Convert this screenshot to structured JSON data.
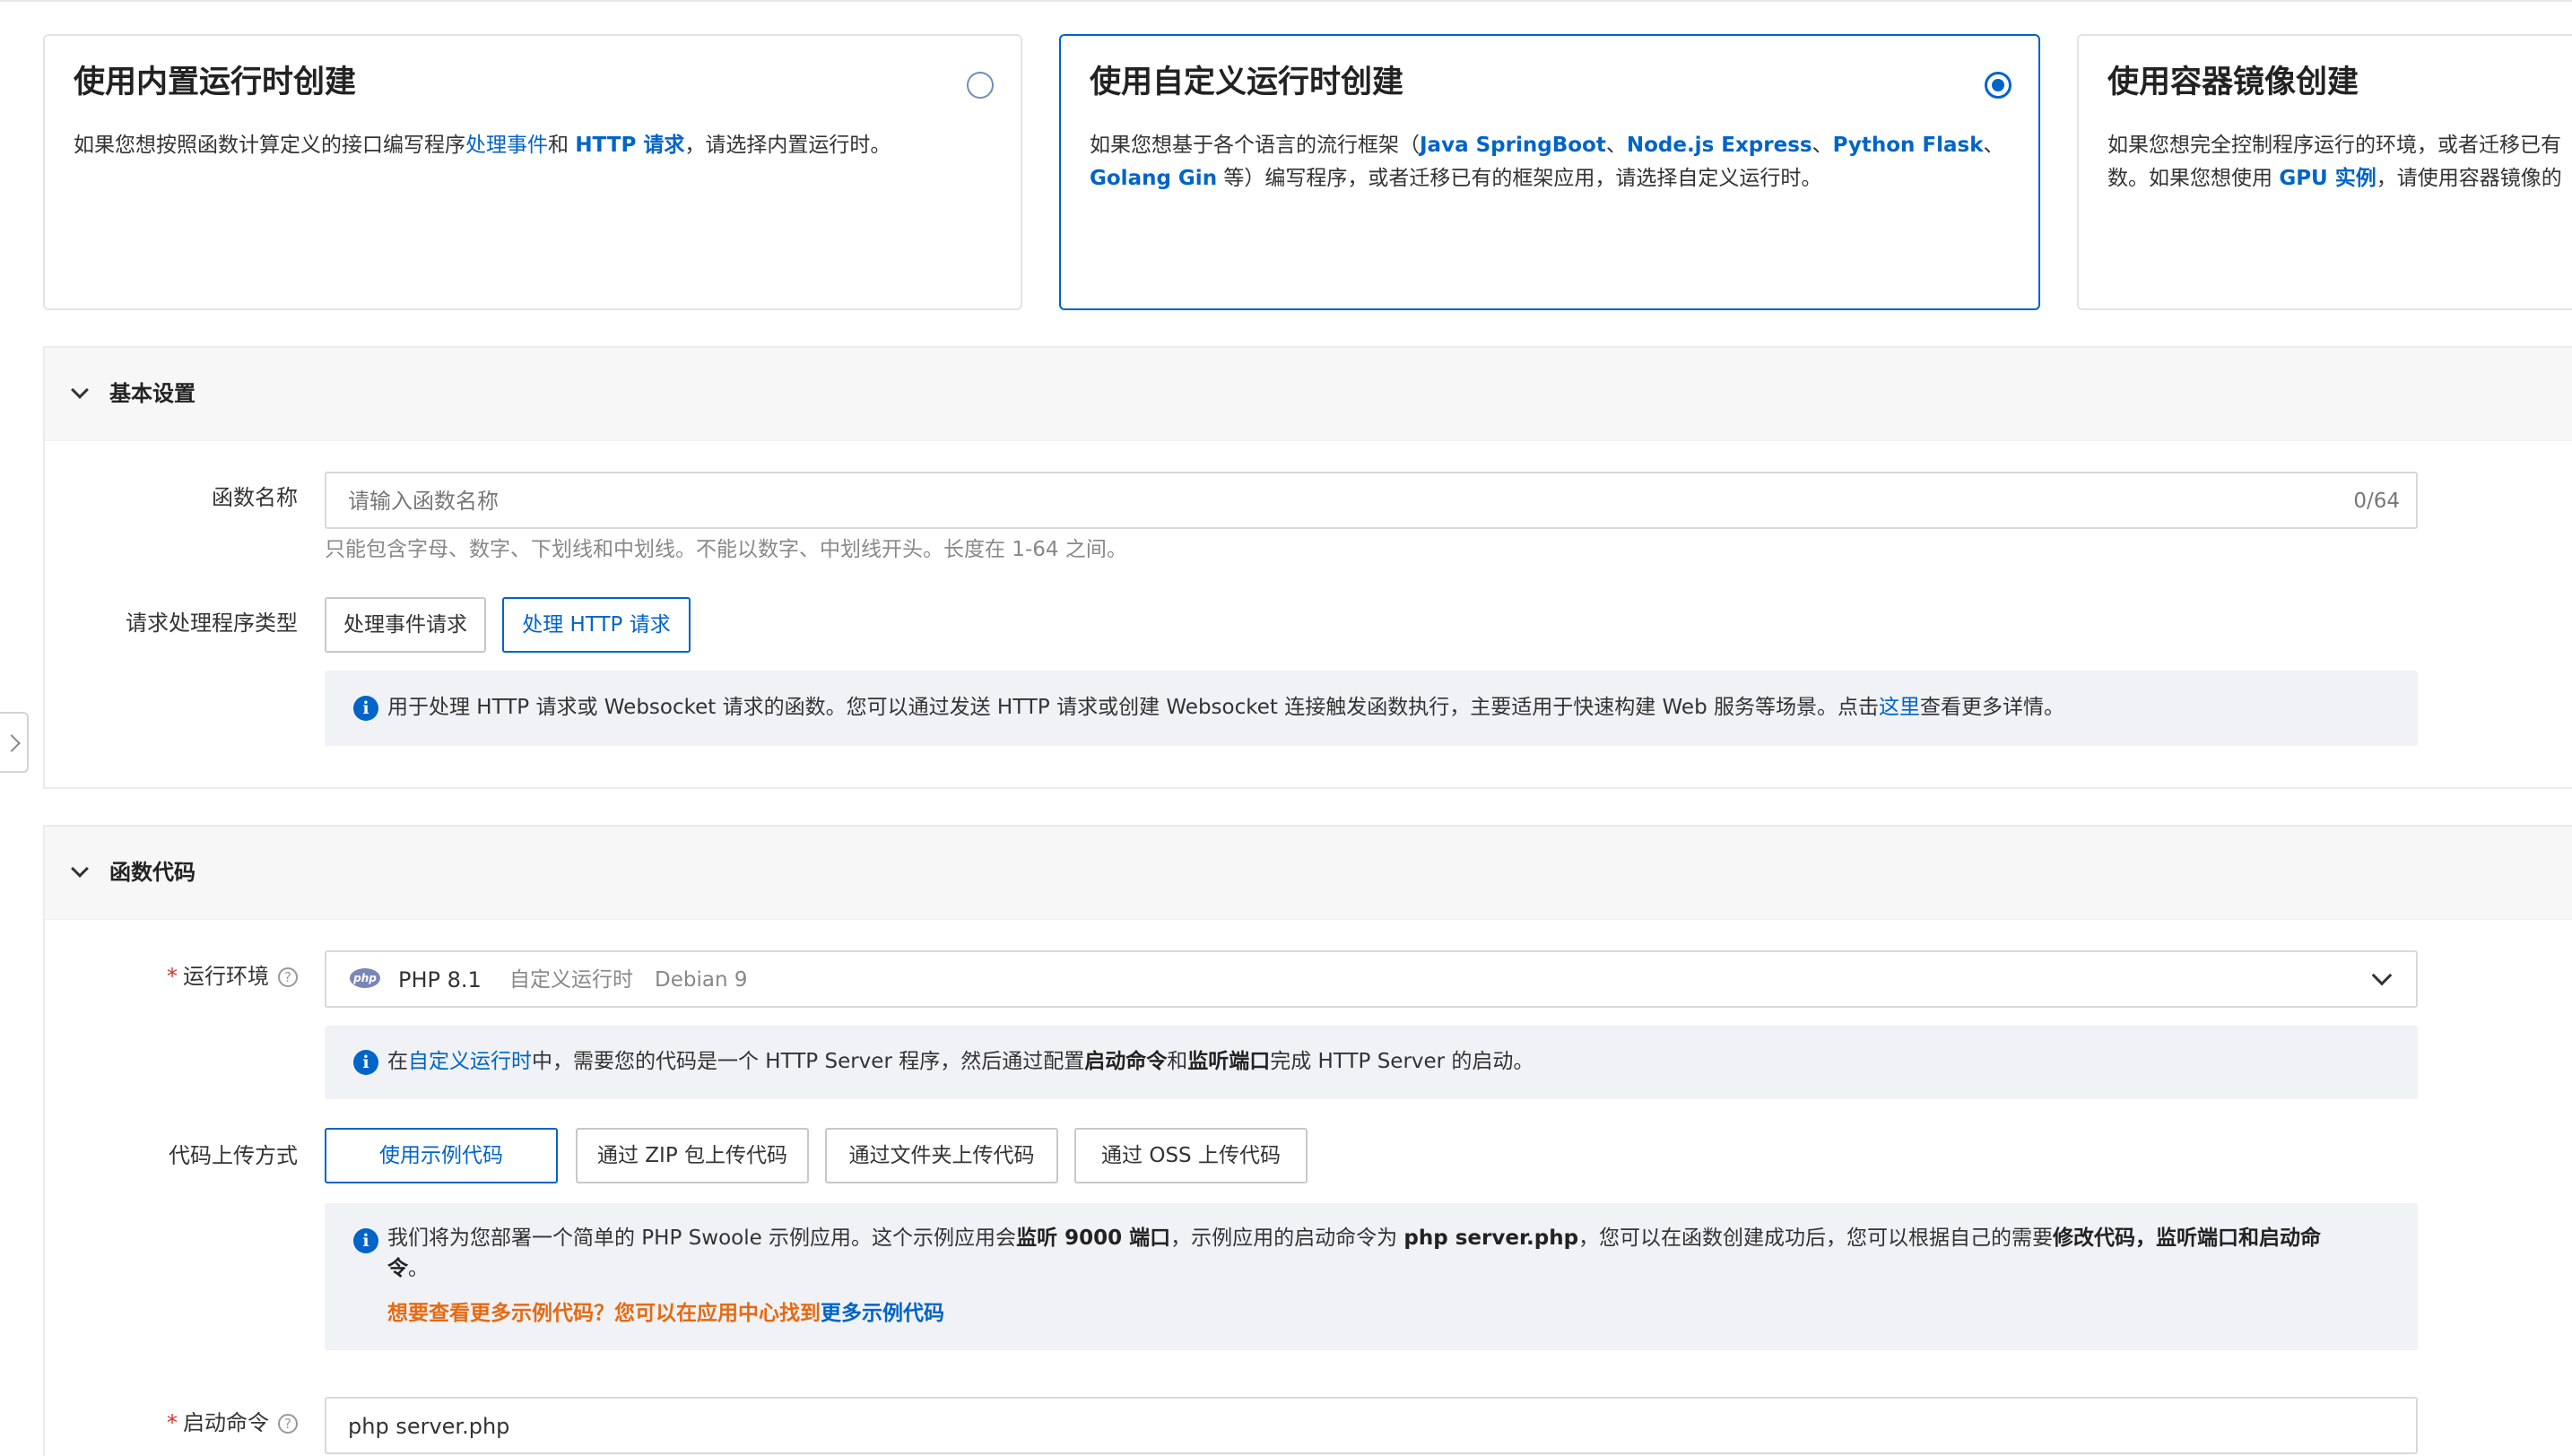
{
  "runtime_cards": [
    {
      "title": "使用内置运行时创建",
      "desc_prefix": "如果您想按照函数计算定义的接口编写程序",
      "link1": "处理事件",
      "mid": "和 ",
      "link2": "HTTP 请求",
      "desc_suffix": "，请选择内置运行时。",
      "selected": false
    },
    {
      "title": "使用自定义运行时创建",
      "line1_prefix": "如果您想基于各个语言的流行框架（",
      "fw1": "Java SpringBoot",
      "sep1": "、",
      "fw2": "Node.js Express",
      "sep2": "、",
      "fw3": "Python Flask",
      "sep3": "、",
      "fw4": "Golang Gin",
      "line2_suffix": " 等）编写程序，或者迁移已有的框架应用，请选择自定义运行时。",
      "selected": true
    },
    {
      "title": "使用容器镜像创建",
      "line1": "如果您想完全控制程序运行的环境，或者迁移已有",
      "line2_prefix": "数。如果您想使用 ",
      "link": "GPU 实例",
      "line2_suffix": "，请使用容器镜像的",
      "selected": false
    }
  ],
  "basic": {
    "section_title": "基本设置",
    "name_label": "函数名称",
    "name_placeholder": "请输入函数名称",
    "name_count": "0/64",
    "name_hint": "只能包含字母、数字、下划线和中划线。不能以数字、中划线开头。长度在 1-64 之间。",
    "handler_label": "请求处理程序类型",
    "handler_options": [
      "处理事件请求",
      "处理 HTTP 请求"
    ],
    "handler_selected": "处理 HTTP 请求",
    "notice_prefix": "用于处理 HTTP 请求或 Websocket 请求的函数。您可以通过发送 HTTP 请求或创建 Websocket 连接触发函数执行，主要适用于快速构建 Web 服务等场景。点击",
    "notice_link": "这里",
    "notice_suffix": "查看更多详情。"
  },
  "code": {
    "section_title": "函数代码",
    "runtime_label": "运行环境",
    "runtime_logo": "php",
    "runtime_name": "PHP 8.1",
    "runtime_type": "自定义运行时",
    "runtime_os": "Debian 9",
    "runtime_notice": {
      "p1": "在",
      "link": "自定义运行时",
      "p2": "中，需要您的代码是一个 HTTP Server 程序，然后通过配置",
      "b1": "启动命令",
      "p3": "和",
      "b2": "监听端口",
      "p4": "完成 HTTP Server 的启动。"
    },
    "upload_label": "代码上传方式",
    "upload_options": [
      "使用示例代码",
      "通过 ZIP 包上传代码",
      "通过文件夹上传代码",
      "通过 OSS 上传代码"
    ],
    "upload_selected": "使用示例代码",
    "sample_notice": {
      "p1": "我们将为您部署一个简单的 PHP Swoole 示例应用。这个示例应用会",
      "b1": "监听 9000 端口",
      "p2": "，示例应用的启动命令为 ",
      "b2": "php server.php",
      "p3": "，您可以在函数创建成功后，您可以根据自己的需要",
      "b3": "修改代码，监听端口和启动命",
      "b3_tail": "令",
      "p4": "。",
      "more_prefix": "想要查看更多示例代码？您可以在应用中心找到",
      "more_link": "更多示例代码"
    },
    "start_cmd_label": "启动命令",
    "start_cmd_value": "php server.php"
  },
  "colors": {
    "accent": "#0064c8",
    "required": "#d93026",
    "warning_text": "#e56a12"
  }
}
